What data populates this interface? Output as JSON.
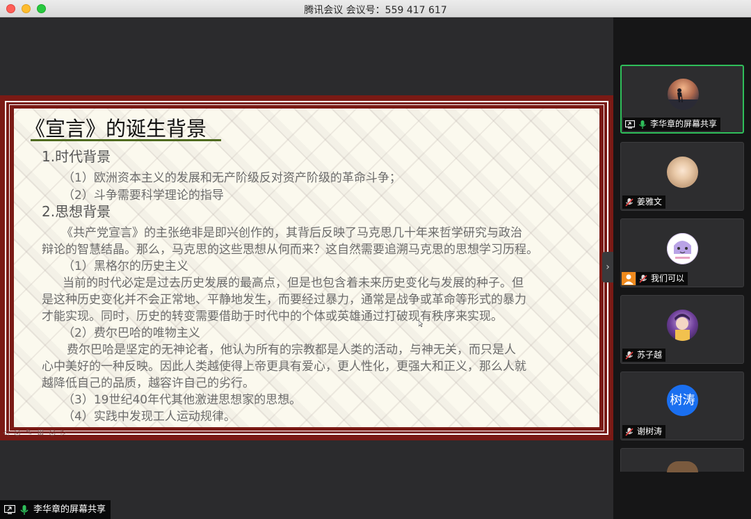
{
  "window": {
    "title": "腾讯会议 会议号：559 417 617"
  },
  "slide": {
    "title": "《宣言》的诞生背景",
    "lines": [
      "1.时代背景",
      "（1）欧洲资本主义的发展和无产阶级反对资产阶级的革命斗争；",
      "（2）斗争需要科学理论的指导",
      "2.思想背景",
      "《共产党宣言》的主张绝非是即兴创作的，其背后反映了马克思几十年来哲学研究与政治",
      "辩论的智慧结晶。那么，马克思的这些思想从何而来？这自然需要追溯马克思的思想学习历程。",
      "（1）黑格尔的历史主义",
      "当前的时代必定是过去历史发展的最高点，但是也包含着未来历史变化与发展的种子。但",
      "是这种历史变化并不会正常地、平静地发生，而要经过暴力，通常是战争或革命等形式的暴力",
      "才能实现。同时，历史的转变需要借助于时代中的个体或英雄通过打破现有秩序来实现。",
      "（2）费尔巴哈的唯物主义",
      "费尔巴哈是坚定的无神论者，他认为所有的宗教都是人类的活动，与神无关，而只是人",
      "心中美好的一种反映。因此人类越使得上帝更具有爱心，更人性化，更强大和正义，那么人就",
      "越降低自己的品质，越容许自己的劣行。",
      "（3）19世纪40年代其他激进思想家的思想。",
      "（4）实践中发现工人运动规律。"
    ]
  },
  "participants": [
    {
      "name": "李华章的屏幕共享",
      "status": "screen-share",
      "avatar": "sunset-photo"
    },
    {
      "name": "姜雅文",
      "status": "muted",
      "avatar": "photo"
    },
    {
      "name": "我们可以",
      "status": "muted",
      "avatar": "cartoon"
    },
    {
      "name": "苏子越",
      "status": "muted",
      "avatar": "cartoon-purple"
    },
    {
      "name": "谢树涛",
      "status": "muted",
      "avatar_text": "树涛"
    }
  ],
  "bottom_label": "李华章的屏幕共享",
  "colors": {
    "slide_border": "#7a1a15",
    "active_tile_border": "#2fbe5a",
    "avatar_blue": "#1a6ff0",
    "title_underline": "#4f6a1f"
  }
}
